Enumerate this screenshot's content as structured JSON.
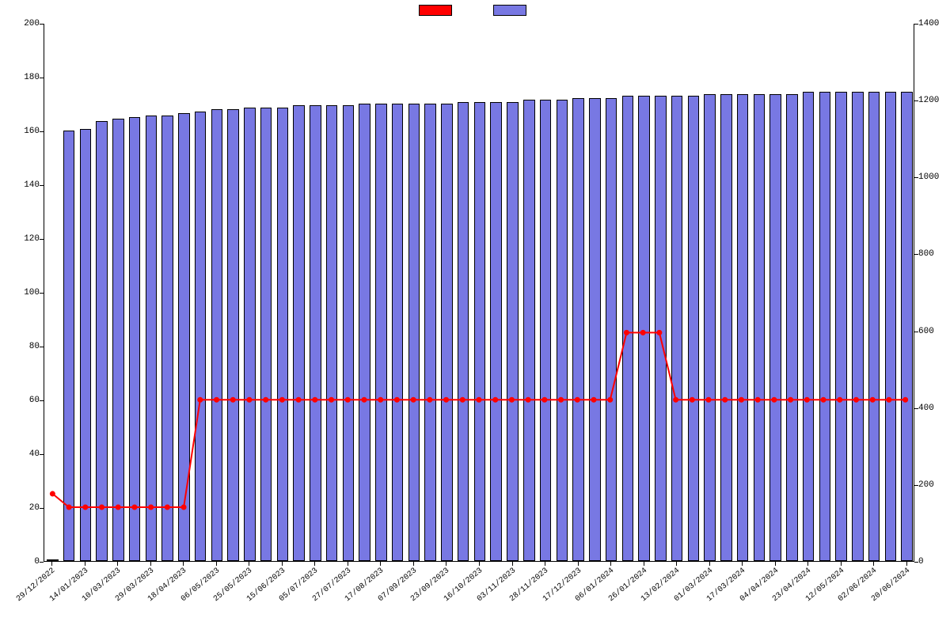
{
  "chart_data": {
    "type": "bar+line",
    "title": "",
    "xlabel": "",
    "ylabel_left": "",
    "ylabel_right": "",
    "y_left": {
      "min": 0,
      "max": 200,
      "ticks": [
        0,
        20,
        40,
        60,
        80,
        100,
        120,
        140,
        160,
        180,
        200
      ]
    },
    "y_right": {
      "min": 0,
      "max": 1400,
      "ticks": [
        0,
        200,
        400,
        600,
        800,
        1000,
        1200,
        1400
      ]
    },
    "categories": [
      "29/12/2022",
      "14/01/2023",
      "10/03/2023",
      "29/03/2023",
      "18/04/2023",
      "06/05/2023",
      "25/05/2023",
      "15/06/2023",
      "05/07/2023",
      "27/07/2023",
      "17/08/2023",
      "07/09/2023",
      "23/09/2023",
      "16/10/2023",
      "03/11/2023",
      "28/11/2023",
      "17/12/2023",
      "06/01/2024",
      "26/01/2024",
      "13/02/2024",
      "01/03/2024",
      "17/03/2024",
      "04/04/2024",
      "23/04/2024",
      "12/05/2024",
      "02/06/2024",
      "20/06/2024"
    ],
    "x_label_every": 1,
    "series": [
      {
        "name": "",
        "type": "line",
        "axis": "left",
        "color": "#ff0000",
        "values": [
          25,
          20,
          20,
          20,
          20,
          20,
          20,
          20,
          20,
          60,
          60,
          60,
          60,
          60,
          60,
          60,
          60,
          60,
          60,
          60,
          60,
          60,
          60,
          60,
          60,
          60,
          60,
          60,
          60,
          60,
          60,
          60,
          60,
          60,
          60,
          85,
          85,
          85,
          60,
          60,
          60,
          60,
          60,
          60,
          60,
          60,
          60,
          60,
          60,
          60,
          60,
          60,
          60
        ]
      },
      {
        "name": "",
        "type": "bar",
        "axis": "right",
        "color": "#7878e3",
        "values": [
          5,
          1120,
          1125,
          1145,
          1150,
          1155,
          1160,
          1160,
          1165,
          1170,
          1175,
          1175,
          1180,
          1180,
          1180,
          1185,
          1185,
          1185,
          1185,
          1190,
          1190,
          1190,
          1190,
          1190,
          1190,
          1195,
          1195,
          1195,
          1195,
          1200,
          1200,
          1200,
          1205,
          1205,
          1205,
          1210,
          1210,
          1210,
          1210,
          1210,
          1215,
          1215,
          1215,
          1215,
          1215,
          1215,
          1220,
          1220,
          1220,
          1220,
          1220,
          1220,
          1220
        ]
      }
    ],
    "categories_full_count": 53,
    "legend_position": "top",
    "grid": false
  },
  "colors": {
    "line": "#ff0000",
    "bar_fill": "#7878e3",
    "axis": "#000000"
  }
}
